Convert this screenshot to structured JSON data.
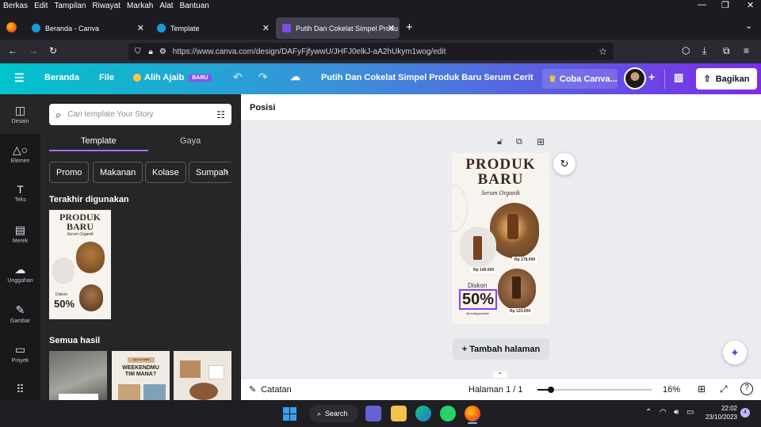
{
  "menubar": {
    "items": [
      "Berkas",
      "Edit",
      "Tampilan",
      "Riwayat",
      "Markah",
      "Alat",
      "Bantuan"
    ]
  },
  "tabs": [
    {
      "label": "Beranda - Canva",
      "color": "#1a9ad9"
    },
    {
      "label": "Template",
      "color": "#1a9ad9"
    },
    {
      "label": "Putih Dan Cokelat Simpel Produ",
      "color": "#7d4ce8"
    }
  ],
  "navbar": {
    "url": "https://www.canva.com/design/DAFyFjfywwU/JHFJ0elkJ-aA2hUkym1wog/edit"
  },
  "canva_header": {
    "home": "Beranda",
    "file": "File",
    "magic": "Alih Ajaib",
    "magic_badge": "BARU",
    "title": "Putih Dan Cokelat Simpel Produk Baru Serum Cerita ...",
    "try": "Coba Canva...",
    "share": "Bagikan"
  },
  "rail": [
    {
      "label": "Desain",
      "icon": "layout-icon"
    },
    {
      "label": "Elemen",
      "icon": "shapes-icon"
    },
    {
      "label": "Teks",
      "icon": "text-icon"
    },
    {
      "label": "Merek",
      "icon": "brand-icon"
    },
    {
      "label": "Unggahan",
      "icon": "upload-icon"
    },
    {
      "label": "Gambar",
      "icon": "draw-icon"
    },
    {
      "label": "Proyek",
      "icon": "folder-icon"
    },
    {
      "label": "",
      "icon": "apps-icon"
    }
  ],
  "panel": {
    "search_placeholder": "Cari template Your Story",
    "tab_template": "Template",
    "tab_style": "Gaya",
    "chips": [
      "Promo",
      "Makanan",
      "Kolase",
      "Sumpah"
    ],
    "recent": "Terakhir digunakan",
    "all": "Semua hasil"
  },
  "design": {
    "title1": "PRODUK",
    "title2": "BARU",
    "subtitle": "Serum Organik",
    "price1": "Rp 178.000",
    "price2": "Rp 149.000",
    "price3": "Rp 123.000",
    "discount_label": "Diskon",
    "discount": "50%",
    "handle": "@reallygreatsite"
  },
  "thumb2": {
    "tag": "Ayo ke kafe",
    "line1": "WEEKENDMU",
    "line2": "TIM MANA?"
  },
  "toolbar": {
    "position": "Posisi"
  },
  "canvas": {
    "add_page": "+ Tambah halaman"
  },
  "bottom": {
    "notes": "Catatan",
    "pages": "Halaman 1 / 1",
    "zoom": "16%"
  },
  "taskbar": {
    "search": "Search",
    "time": "22:02",
    "date": "23/10/2023",
    "notif": "4"
  },
  "colors": {
    "brown": "#3b2a1e",
    "purple": "#7d2ae8",
    "teal": "#00c4cc"
  }
}
